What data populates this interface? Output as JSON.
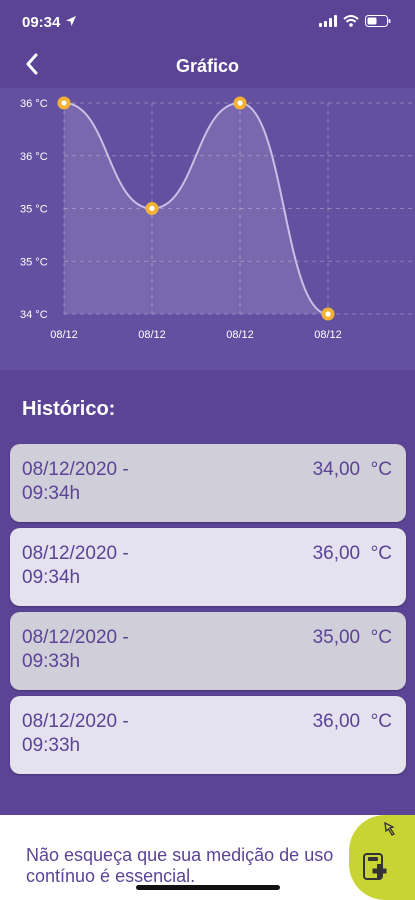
{
  "status_bar": {
    "time": "09:34",
    "location_icon": "location-arrow-icon",
    "signal_icon": "cellular-signal-icon",
    "wifi_icon": "wifi-icon",
    "battery_icon": "battery-icon"
  },
  "nav": {
    "title": "Gráfico",
    "back_icon": "chevron-left-icon"
  },
  "chart_data": {
    "type": "line",
    "title": "",
    "xlabel": "",
    "ylabel": "",
    "categories": [
      "08/12",
      "08/12",
      "08/12",
      "08/12"
    ],
    "values": [
      36,
      35,
      36,
      34
    ],
    "ylim": [
      34,
      36
    ],
    "y_tick_labels": [
      "36 °C",
      "36 °C",
      "35 °C",
      "35 °C",
      "34 °C"
    ],
    "x_tick_labels": [
      "08/12",
      "08/12",
      "08/12",
      "08/12"
    ],
    "grid": true,
    "area_fill": true,
    "line_color": "#c9bfe6",
    "marker_color": "#f2b233"
  },
  "history": {
    "title": "Histórico:",
    "items": [
      {
        "date": "08/12/2020 -",
        "time": "09:34h",
        "value": "34,00",
        "unit": "°C"
      },
      {
        "date": "08/12/2020 -",
        "time": "09:34h",
        "value": "36,00",
        "unit": "°C"
      },
      {
        "date": "08/12/2020 -",
        "time": "09:33h",
        "value": "35,00",
        "unit": "°C"
      },
      {
        "date": "08/12/2020 -",
        "time": "09:33h",
        "value": "36,00",
        "unit": "°C"
      }
    ]
  },
  "banner": {
    "text": "Não esqueça que sua medição de uso contínuo é essencial.",
    "icon": "medical-device-icon",
    "pin_icon": "pin-icon"
  },
  "colors": {
    "background": "#5b4496",
    "chart_background": "#6450a0",
    "accent": "#c7d433",
    "card_text": "#5b4496"
  }
}
